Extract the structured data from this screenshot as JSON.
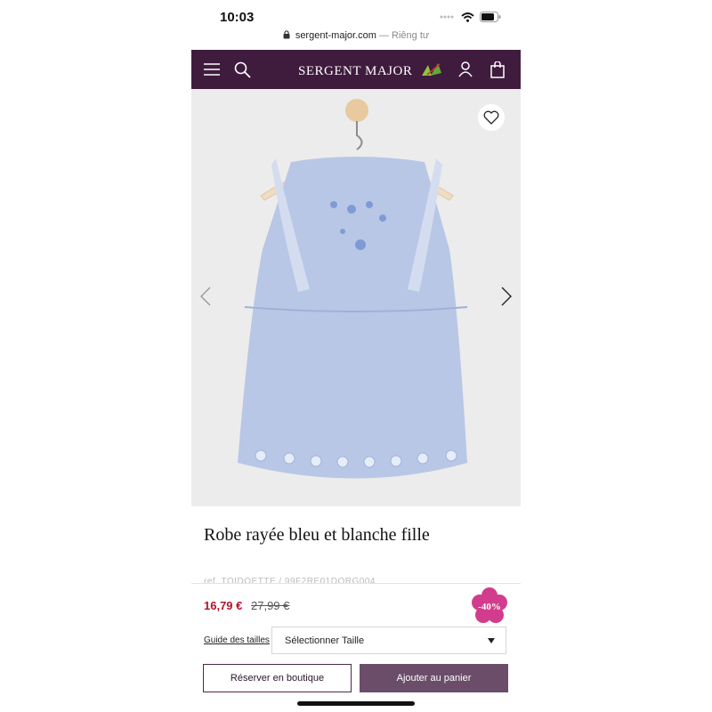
{
  "status": {
    "time": "10:03"
  },
  "browser": {
    "domain": "sergent-major.com",
    "privacy": "— Riêng tư"
  },
  "nav": {
    "brand": "SERGENT MAJOR"
  },
  "product": {
    "title": "Robe rayée bleu et blanche fille",
    "ref": "ref. TOIDOETTE / 99F2RE01DORG004",
    "price": "16,79 €",
    "old_price": "27,99 €",
    "discount": "-40%"
  },
  "size": {
    "guide_label": "Guide des tailles",
    "select_value": "Sélectionner Taille"
  },
  "actions": {
    "reserve_label": "Réserver en boutique",
    "add_to_cart_label": "Ajouter au panier"
  },
  "colors": {
    "nav_bg": "#3f1b3d",
    "price": "#b3142a",
    "cta": "#6b4d69",
    "badge": "#d23c8c"
  }
}
